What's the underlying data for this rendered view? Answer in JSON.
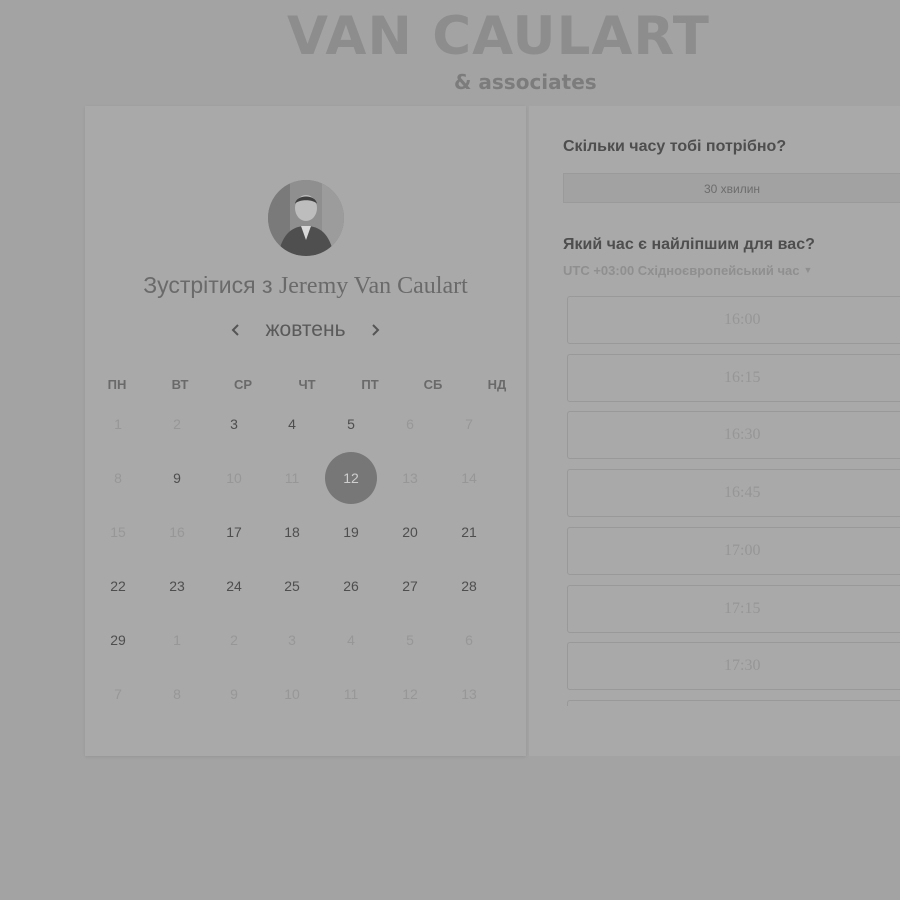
{
  "logo": {
    "brand": "VAN CAULART",
    "tagline": "& associates"
  },
  "host": {
    "prefix": "Зустрітися з",
    "name": "Jeremy Van Caulart"
  },
  "calendar": {
    "month": "жовтень",
    "prev_icon": "chevron-left-icon",
    "next_icon": "chevron-right-icon",
    "weekdays": [
      "ПН",
      "ВТ",
      "СР",
      "ЧТ",
      "ПТ",
      "СБ",
      "НД"
    ],
    "weeks": [
      [
        {
          "d": "1",
          "a": false
        },
        {
          "d": "2",
          "a": false
        },
        {
          "d": "3",
          "a": true
        },
        {
          "d": "4",
          "a": true
        },
        {
          "d": "5",
          "a": true
        },
        {
          "d": "6",
          "a": false
        },
        {
          "d": "7",
          "a": false
        }
      ],
      [
        {
          "d": "8",
          "a": false
        },
        {
          "d": "9",
          "a": true
        },
        {
          "d": "10",
          "a": false
        },
        {
          "d": "11",
          "a": false
        },
        {
          "d": "12",
          "a": true,
          "selected": true
        },
        {
          "d": "13",
          "a": false
        },
        {
          "d": "14",
          "a": false
        }
      ],
      [
        {
          "d": "15",
          "a": false
        },
        {
          "d": "16",
          "a": false
        },
        {
          "d": "17",
          "a": true
        },
        {
          "d": "18",
          "a": true
        },
        {
          "d": "19",
          "a": true
        },
        {
          "d": "20",
          "a": true
        },
        {
          "d": "21",
          "a": true
        }
      ],
      [
        {
          "d": "22",
          "a": true
        },
        {
          "d": "23",
          "a": true
        },
        {
          "d": "24",
          "a": true
        },
        {
          "d": "25",
          "a": true
        },
        {
          "d": "26",
          "a": true
        },
        {
          "d": "27",
          "a": true
        },
        {
          "d": "28",
          "a": true
        }
      ],
      [
        {
          "d": "29",
          "a": true
        },
        {
          "d": "1",
          "a": false
        },
        {
          "d": "2",
          "a": false
        },
        {
          "d": "3",
          "a": false
        },
        {
          "d": "4",
          "a": false
        },
        {
          "d": "5",
          "a": false
        },
        {
          "d": "6",
          "a": false
        }
      ],
      [
        {
          "d": "7",
          "a": false
        },
        {
          "d": "8",
          "a": false
        },
        {
          "d": "9",
          "a": false
        },
        {
          "d": "10",
          "a": false
        },
        {
          "d": "11",
          "a": false
        },
        {
          "d": "12",
          "a": false
        },
        {
          "d": "13",
          "a": false
        }
      ]
    ]
  },
  "booking": {
    "duration_question": "Скільки часу тобі потрібно?",
    "duration_value": "30 хвилин",
    "time_question": "Який час є найліпшим для вас?",
    "timezone": "UTC +03:00 Східноєвропейський час",
    "timezone_icon": "caret-down-icon",
    "slots": [
      "16:00",
      "16:15",
      "16:30",
      "16:45",
      "17:00",
      "17:15",
      "17:30",
      ""
    ]
  }
}
